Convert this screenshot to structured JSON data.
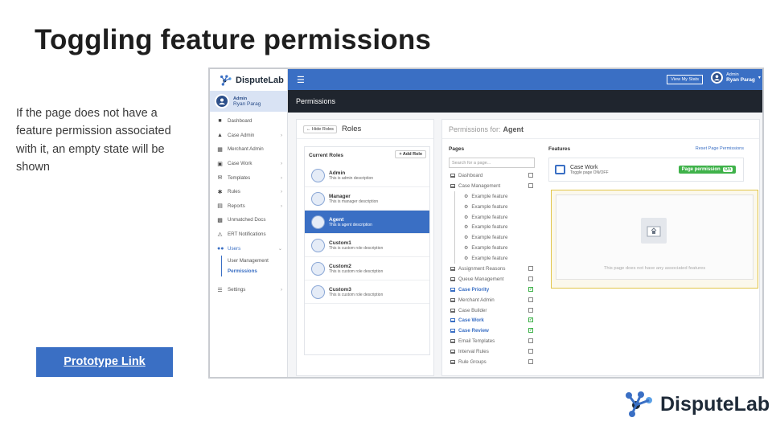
{
  "slide": {
    "title": "Toggling feature permissions",
    "description": "If the page does not have a feature permission associated with it, an empty state will be shown",
    "prototype_link": "Prototype  Link",
    "brand": "DisputeLab"
  },
  "app": {
    "brand": "DisputeLab",
    "user": {
      "role": "Admin",
      "name": "Ryan Parag"
    },
    "topbar": {
      "view_stats": "View My Stats",
      "role": "Admin",
      "name": "Ryan Parag"
    },
    "page_title": "Permissions",
    "nav": [
      {
        "label": "Dashboard",
        "icon": "dashboard-icon",
        "chevron": false
      },
      {
        "label": "Case Admin",
        "icon": "case-admin-icon",
        "chevron": true
      },
      {
        "label": "Merchant Admin",
        "icon": "merchant-admin-icon",
        "chevron": false
      },
      {
        "label": "Case Work",
        "icon": "case-work-icon",
        "chevron": true
      },
      {
        "label": "Templates",
        "icon": "templates-icon",
        "chevron": true
      },
      {
        "label": "Rules",
        "icon": "rules-icon",
        "chevron": true
      },
      {
        "label": "Reports",
        "icon": "reports-icon",
        "chevron": true
      },
      {
        "label": "Unmatched Docs",
        "icon": "unmatched-docs-icon",
        "chevron": false
      },
      {
        "label": "ERT Notifications",
        "icon": "warning-icon",
        "chevron": false
      },
      {
        "label": "Users",
        "icon": "users-icon",
        "chevron": true
      }
    ],
    "users_sub": [
      "User Management",
      "Permissions"
    ],
    "settings_label": "Settings",
    "roles_panel": {
      "hide_label": "Hide Roles",
      "title": "Roles",
      "current_roles": "Current Roles",
      "add_role": "Add Role",
      "roles": [
        {
          "name": "Admin",
          "desc": "This is admin description"
        },
        {
          "name": "Manager",
          "desc": "This is manager description"
        },
        {
          "name": "Agent",
          "desc": "This is agent description"
        },
        {
          "name": "Custom1",
          "desc": "This is custom role description"
        },
        {
          "name": "Custom2",
          "desc": "This is custom role description"
        },
        {
          "name": "Custom3",
          "desc": "This is custom role description"
        }
      ],
      "selected": "Agent"
    },
    "permissions": {
      "for_label": "Permissions for:",
      "role": "Agent",
      "pages_label": "Pages",
      "search_placeholder": "Search for a page...",
      "features_label": "Features",
      "reset_label": "Reset Page Permissions",
      "pages": [
        {
          "label": "Dashboard",
          "checked": false,
          "sub": false
        },
        {
          "label": "Case Management",
          "checked": false,
          "sub": false
        },
        {
          "label": "Example feature",
          "checked": false,
          "sub": true
        },
        {
          "label": "Example feature",
          "checked": false,
          "sub": true
        },
        {
          "label": "Example feature",
          "checked": false,
          "sub": true
        },
        {
          "label": "Example feature",
          "checked": false,
          "sub": true
        },
        {
          "label": "Example feature",
          "checked": false,
          "sub": true
        },
        {
          "label": "Example feature",
          "checked": false,
          "sub": true
        },
        {
          "label": "Example feature",
          "checked": false,
          "sub": true
        },
        {
          "label": "Assignment Reasons",
          "checked": false,
          "sub": false
        },
        {
          "label": "Queue Management",
          "checked": false,
          "sub": false
        },
        {
          "label": "Case Priority",
          "checked": true,
          "sub": false
        },
        {
          "label": "Merchant Admin",
          "checked": false,
          "sub": false
        },
        {
          "label": "Case Builder",
          "checked": false,
          "sub": false
        },
        {
          "label": "Case Work",
          "checked": true,
          "sub": false
        },
        {
          "label": "Case Review",
          "checked": true,
          "sub": false
        },
        {
          "label": "Email Templates",
          "checked": false,
          "sub": false
        },
        {
          "label": "Interval Rules",
          "checked": false,
          "sub": false
        },
        {
          "label": "Rule Groups",
          "checked": false,
          "sub": false
        }
      ],
      "feature_card": {
        "name": "Case Work",
        "sub": "Toggle page ON/OFF",
        "button": "Page permission",
        "state": "On"
      },
      "empty_text": "This page does not have any associated features"
    }
  }
}
